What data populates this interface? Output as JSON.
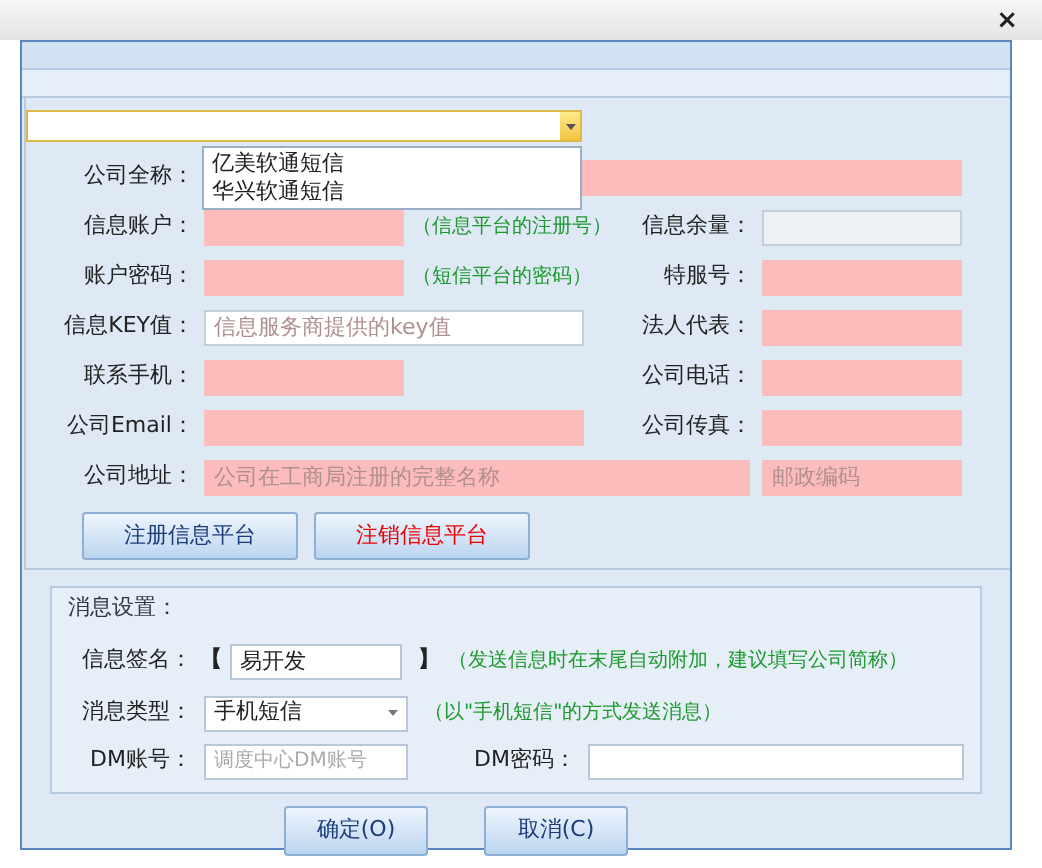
{
  "window": {
    "close": "×"
  },
  "combo": {
    "expanded": true,
    "options": [
      {
        "label": "亿美软通短信",
        "selected": false
      },
      {
        "label": "华兴软通短信",
        "selected": false
      }
    ]
  },
  "rows": [
    {
      "label": "公司全称：",
      "field": {
        "required": true,
        "readonly": false
      }
    },
    {
      "label": "信息账户：",
      "field": {
        "required": true,
        "readonly": false
      },
      "hint": "（信息平台的注册号）",
      "right": {
        "label": "信息余量：",
        "field": {
          "required": false,
          "readonly": true
        }
      }
    },
    {
      "label": "账户密码：",
      "field": {
        "required": true,
        "readonly": false
      },
      "hint": "（短信平台的密码）",
      "right": {
        "label": "特服号：",
        "field": {
          "required": true,
          "readonly": false
        }
      }
    },
    {
      "label": "信息KEY值：",
      "field": {
        "required": false,
        "readonly": false,
        "placeholder": "信息服务商提供的key值"
      },
      "right": {
        "label": "法人代表：",
        "field": {
          "required": true,
          "readonly": false
        }
      }
    },
    {
      "label": "联系手机：",
      "field": {
        "required": true,
        "readonly": false
      },
      "right": {
        "label": "公司电话：",
        "field": {
          "required": true,
          "readonly": false
        }
      }
    },
    {
      "label": "公司Email：",
      "field": {
        "required": true,
        "readonly": false
      },
      "right": {
        "label": "公司传真：",
        "field": {
          "required": true,
          "readonly": false
        }
      }
    },
    {
      "label": "公司地址：",
      "field": {
        "required": true,
        "readonly": false,
        "placeholder": "公司在工商局注册的完整名称"
      },
      "right": {
        "field": {
          "required": true,
          "readonly": false,
          "placeholder": "邮政编码"
        }
      }
    }
  ],
  "platform_buttons": [
    {
      "label": "注册信息平台",
      "kind": "normal"
    },
    {
      "label": "注销信息平台",
      "kind": "danger"
    }
  ],
  "message_settings": {
    "title": "消息设置：",
    "signature": {
      "label": "信息签名：",
      "open": "【",
      "value": "易开发",
      "close": "】",
      "hint": "（发送信息时在末尾自动附加，建议填写公司简称）"
    },
    "type": {
      "label": "消息类型：",
      "value": "手机短信",
      "hint": "（以\"手机短信\"的方式发送消息）"
    },
    "dm_account": {
      "label": "DM账号：",
      "placeholder": "调度中心DM账号"
    },
    "dm_password": {
      "label": "DM密码："
    }
  },
  "buttons": [
    "确定(O)",
    "取消(C)"
  ]
}
